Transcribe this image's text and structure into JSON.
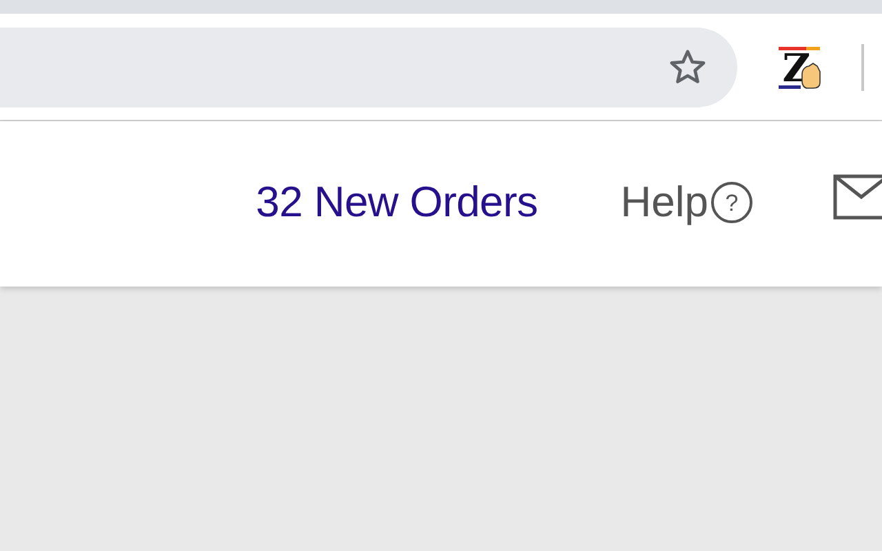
{
  "browser": {
    "extension": {
      "letter": "Z"
    }
  },
  "header": {
    "new_orders": "32 New Orders",
    "help": "Help",
    "help_symbol": "?"
  }
}
